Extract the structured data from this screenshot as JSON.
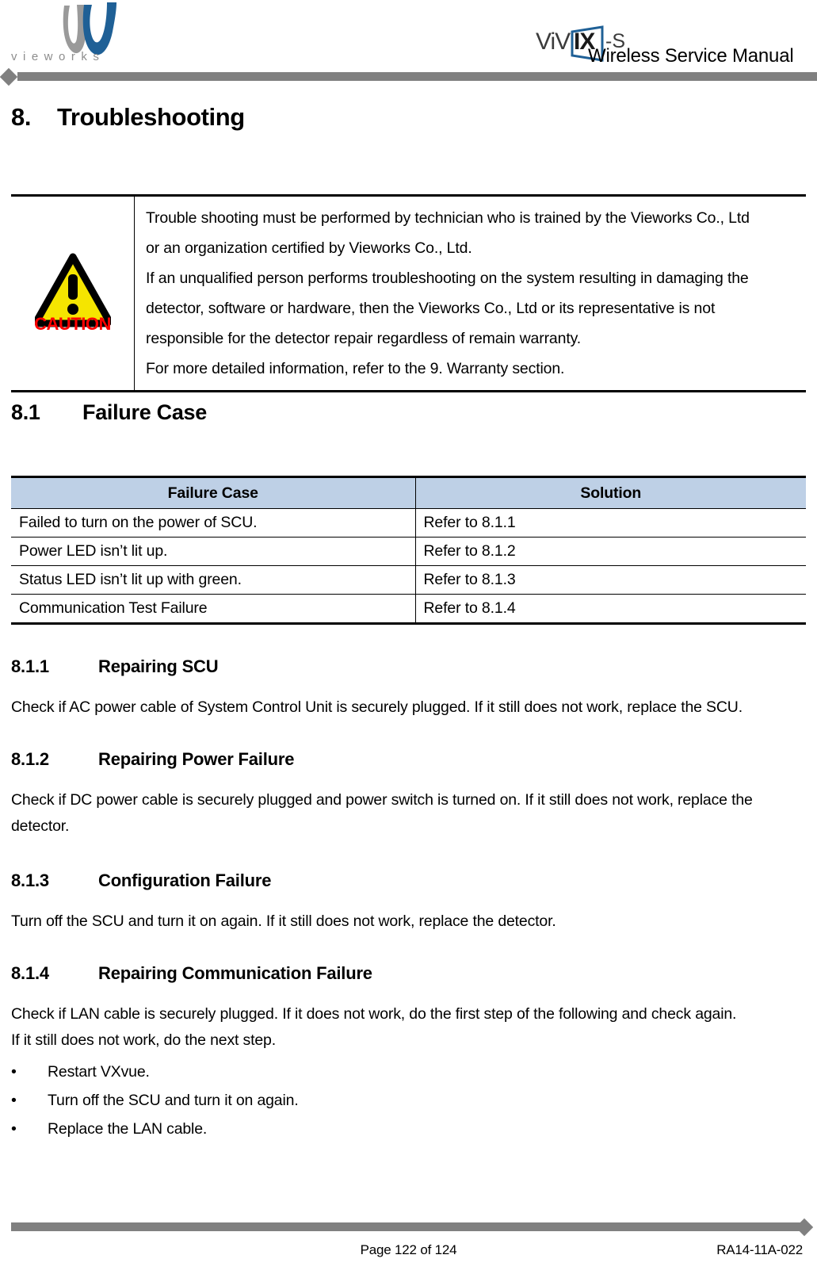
{
  "header": {
    "company_logo_name": "vieworks-logo",
    "company_wordmark": "vieworks",
    "product_logo_text_1": "ViV",
    "product_logo_text_2": "IX",
    "product_logo_text_3": "-S",
    "manual_title": "Wireless Service Manual"
  },
  "chapter": {
    "number": "8.",
    "title": "Troubleshooting"
  },
  "caution": {
    "icon_name": "caution-triangle-icon",
    "icon_label": "CAUTION",
    "icon_fill": "#F5E500",
    "icon_stroke": "#000000",
    "label_color": "#FF0000",
    "lines": [
      "Trouble shooting must be performed by technician who is trained by the Vieworks Co., Ltd",
      "or an organization certified by Vieworks Co., Ltd.",
      "If an unqualified person performs troubleshooting on the system resulting in damaging the",
      "detector, software or hardware, then the Vieworks Co., Ltd or its representative is not",
      "responsible for the detector repair regardless of remain warranty.",
      "For more detailed information, refer to the 9. Warranty section."
    ]
  },
  "section_8_1": {
    "number": "8.1",
    "title": "Failure Case",
    "table": {
      "header_bg": "#BED0E6",
      "columns": [
        "Failure Case",
        "Solution"
      ],
      "rows": [
        [
          "Failed to turn on the power of SCU.",
          "Refer to 8.1.1"
        ],
        [
          "Power LED isn’t lit up.",
          "Refer to 8.1.2"
        ],
        [
          "Status LED isn’t lit up with green.",
          "Refer to 8.1.3"
        ],
        [
          "Communication Test Failure",
          "Refer to 8.1.4"
        ]
      ]
    }
  },
  "section_8_1_1": {
    "number": "8.1.1",
    "title": "Repairing SCU",
    "body": "Check if AC power cable of System Control Unit is securely plugged. If it still does not work, replace the SCU."
  },
  "section_8_1_2": {
    "number": "8.1.2",
    "title": "Repairing Power Failure",
    "body": "Check if DC power cable is securely plugged and power switch is turned on. If it still does not work, replace the detector."
  },
  "section_8_1_3": {
    "number": "8.1.3",
    "title": "Configuration Failure",
    "body": "Turn off the SCU and turn it on again. If it still does not work, replace the detector."
  },
  "section_8_1_4": {
    "number": "8.1.4",
    "title": "Repairing Communication Failure",
    "body_line_1": "Check if LAN cable is securely plugged. If it does not work, do the first step of the following and check again.",
    "body_line_2": "If it still does not work, do the next step.",
    "bullet_char": "•",
    "bullets": [
      "Restart VXvue.",
      "Turn off the SCU and turn it on again.",
      "Replace the LAN cable."
    ]
  },
  "footer": {
    "page_label": "Page 122 of 124",
    "doc_number": "RA14-11A-022",
    "bar_color": "#808080"
  }
}
